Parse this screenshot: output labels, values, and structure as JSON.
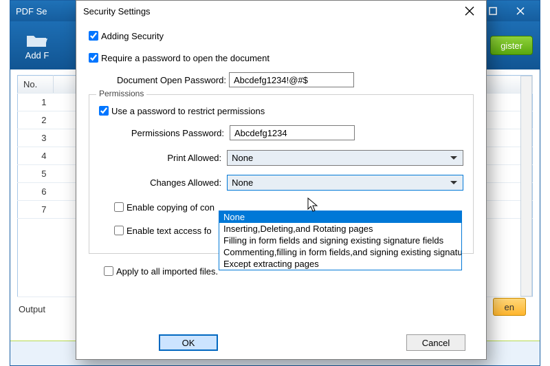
{
  "main": {
    "title_prefix": "PDF Se",
    "win_min": "—",
    "win_max": "▢",
    "win_close": "✕",
    "toolbar": {
      "add_file": "Add F"
    },
    "register_btn": "gister",
    "table": {
      "col_no": "No.",
      "rows": [
        "1",
        "2",
        "3",
        "4",
        "5",
        "6",
        "7"
      ]
    },
    "output_label": "Output",
    "open_btn": "en"
  },
  "modal": {
    "title": "Security Settings",
    "close": "✕",
    "adding_security": "Adding Security",
    "require_password": "Require a password to open the document",
    "doc_pass_label": "Document Open Password:",
    "doc_pass_value": "Abcdefg1234!@#$",
    "permissions_legend": "Permissions",
    "use_password_restrict": "Use a password to restrict permissions",
    "perm_pass_label": "Permissions Password:",
    "perm_pass_value": "Abcdefg1234",
    "print_allowed_label": "Print Allowed:",
    "print_allowed_value": "None",
    "changes_allowed_label": "Changes Allowed:",
    "changes_allowed_value": "None",
    "changes_allowed_options": [
      "None",
      "Inserting,Deleting,and Rotating pages",
      "Filling in form fields and signing existing signature fields",
      "Commenting,filling in form fields,and signing existing signature",
      "Except extracting pages"
    ],
    "enable_copying": "Enable copying of con",
    "enable_text_access": "Enable text access fo",
    "apply_all": "Apply to all imported files.",
    "ok": "OK",
    "cancel": "Cancel"
  }
}
